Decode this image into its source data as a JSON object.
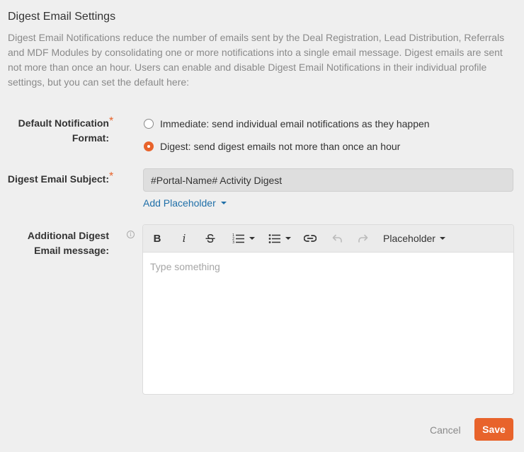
{
  "section": {
    "title": "Digest Email Settings",
    "description": "Digest Email Notifications reduce the number of emails sent by the Deal Registration, Lead Distribution, Referrals and MDF Modules by consolidating one or more notifications into a single email message. Digest emails are sent not more than once an hour. Users can enable and disable Digest Email Notifications in their individual profile settings, but you can set the default here:"
  },
  "notification_format": {
    "label_line1": "Default Notification",
    "label_line2": "Format:",
    "required_mark": "*",
    "options": [
      {
        "label": "Immediate: send individual email notifications as they happen",
        "selected": false
      },
      {
        "label": "Digest: send digest emails not more than once an hour",
        "selected": true
      }
    ]
  },
  "subject": {
    "label": "Digest Email Subject:",
    "required_mark": "*",
    "value": "#Portal-Name# Activity Digest",
    "add_placeholder_label": "Add Placeholder"
  },
  "message": {
    "label_line1": "Additional Digest",
    "label_line2": "Email message:",
    "info_icon": "i",
    "toolbar": {
      "bold": "B",
      "italic": "i",
      "placeholder_label": "Placeholder"
    },
    "placeholder": "Type something"
  },
  "actions": {
    "cancel_label": "Cancel",
    "save_label": "Save"
  },
  "colors": {
    "accent": "#e8632b",
    "link": "#1f6fa8",
    "background": "#efefef"
  }
}
